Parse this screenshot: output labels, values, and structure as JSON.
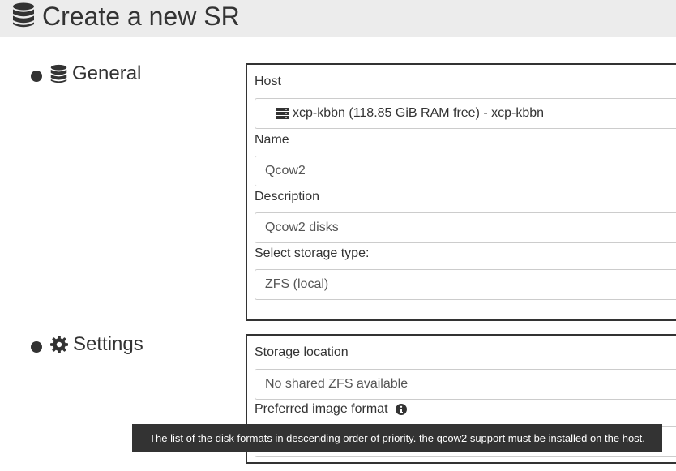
{
  "header": {
    "title": "Create a new SR",
    "icon": "database-icon"
  },
  "sections": {
    "general": {
      "heading": "General",
      "icon": "database-icon",
      "host_label": "Host",
      "host_value": "xcp-kbbn (118.85 GiB RAM free) - xcp-kbbn",
      "host_icon": "server-icon",
      "name_label": "Name",
      "name_value": "Qcow2",
      "description_label": "Description",
      "description_value": "Qcow2 disks",
      "storage_type_label": "Select storage type:",
      "storage_type_value": "ZFS (local)"
    },
    "settings": {
      "heading": "Settings",
      "icon": "gear-icon",
      "storage_location_label": "Storage location",
      "storage_location_value": "No shared ZFS available",
      "preferred_format_label": "Preferred image format",
      "preferred_format_icon": "info-circle-icon"
    }
  },
  "tooltip": {
    "text": "The list of the disk formats in descending order of priority. the qcow2 support must be installed on the host."
  },
  "colors": {
    "header_bg": "#ececec",
    "text": "#333333",
    "tooltip_bg": "#333333",
    "field_border": "#cccccc"
  }
}
